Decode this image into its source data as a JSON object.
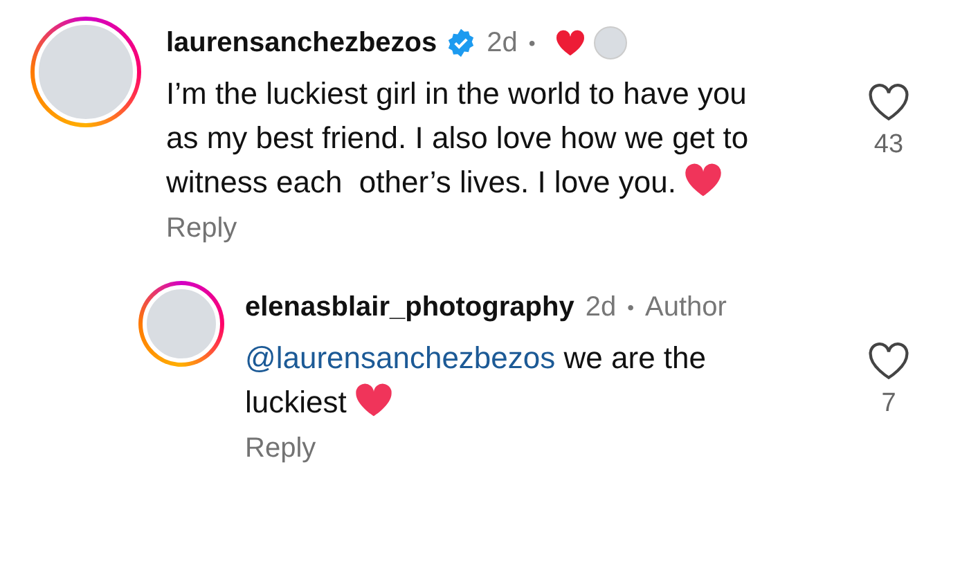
{
  "comments": [
    {
      "kind": "top",
      "username": "laurensanchezbezos",
      "verified": true,
      "time": "2d",
      "separator": "•",
      "liked_by_author": true,
      "text": "I’m the luckiest girl in the world to have you as my best friend. I also love how we get to witness each  other’s lives. I love you.",
      "ends_with_heart": true,
      "likes": "43",
      "reply": "Reply"
    },
    {
      "kind": "reply",
      "username": "elenasblair_photography",
      "verified": false,
      "time": "2d",
      "separator": "•",
      "author_label": "Author",
      "liked_by_author": false,
      "mention": "@laurensanchezbezos",
      "text": "we are the luckiest",
      "ends_with_heart": true,
      "likes": "7",
      "reply": "Reply"
    }
  ]
}
